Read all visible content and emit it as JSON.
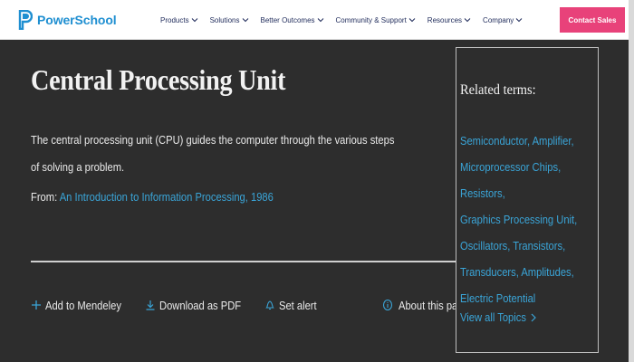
{
  "header": {
    "brand": "PowerSchool",
    "nav": [
      {
        "label": "Products"
      },
      {
        "label": "Solutions"
      },
      {
        "label": "Better Outcomes"
      },
      {
        "label": "Community & Support"
      },
      {
        "label": "Resources"
      },
      {
        "label": "Company"
      }
    ],
    "contact_label": "Contact Sales"
  },
  "article": {
    "title": "Central Processing Unit",
    "description": "The central processing unit (CPU) guides the computer through the various steps of solving a problem.",
    "from_prefix": "From:",
    "from_link": "An Introduction to Information Processing, 1986"
  },
  "actions": {
    "add_mendeley": "Add to Mendeley",
    "download_pdf": "Download as PDF",
    "set_alert": "Set alert",
    "about_page": "About this page"
  },
  "related": {
    "title": "Related terms:",
    "terms": [
      "Semiconductor",
      "Amplifier",
      "Microprocessor Chips",
      "Resistors",
      "Graphics Processing Unit",
      "Oscillators",
      "Transistors",
      "Transducers",
      "Amplitudes",
      "Electric Potential"
    ],
    "view_all": "View all Topics"
  },
  "colors": {
    "background": "#2d2d2d",
    "link": "#3aa5d8",
    "brand": "#1f8fd1",
    "cta": "#e8427a"
  }
}
